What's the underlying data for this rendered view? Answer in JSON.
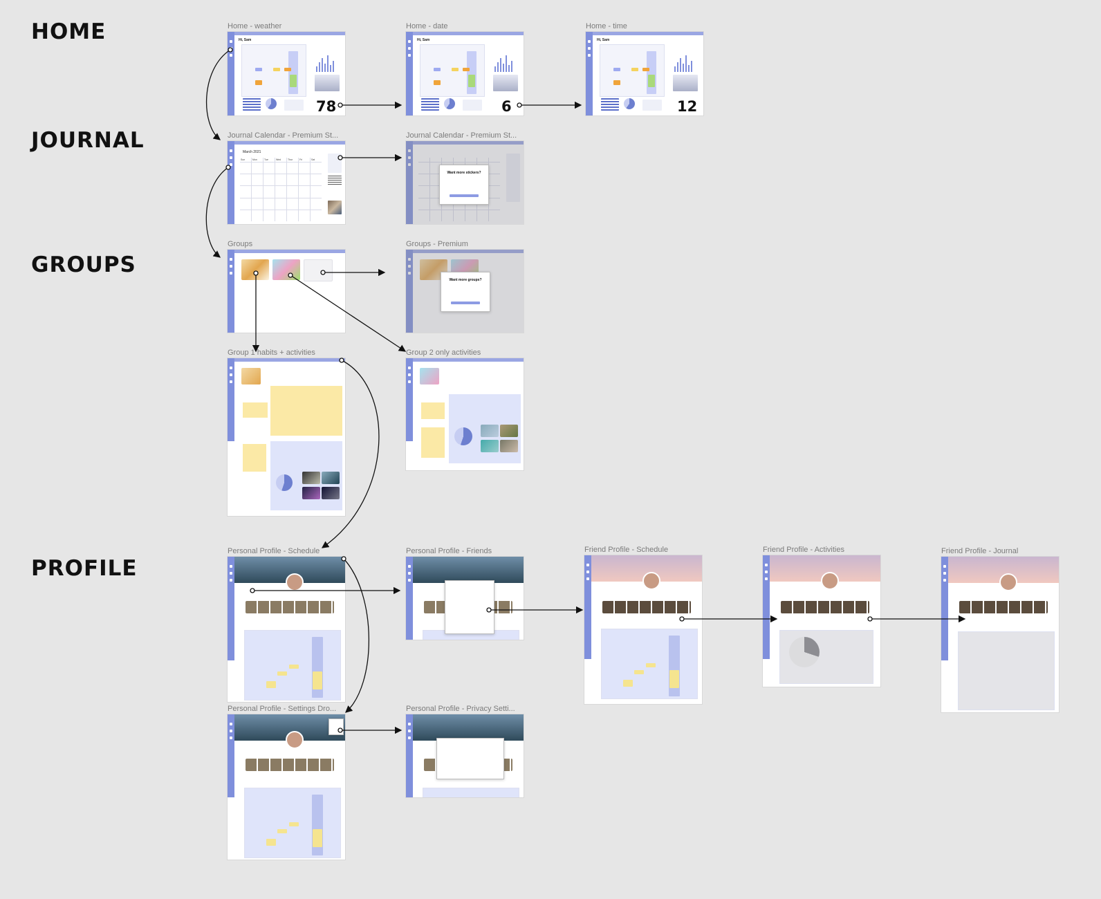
{
  "sections": {
    "home": "HOME",
    "journal": "JOURNAL",
    "groups": "GROUPS",
    "profile": "PROFILE"
  },
  "frames": {
    "home_weather": {
      "title": "Home - weather",
      "greeting": "Hi, Sam",
      "big_value": "78"
    },
    "home_date": {
      "title": "Home - date",
      "greeting": "Hi, Sam",
      "big_value": "6"
    },
    "home_time": {
      "title": "Home - time",
      "greeting": "Hi, Sam",
      "big_value": "12"
    },
    "journal_calendar": {
      "title": "Journal Calendar - Premium St...",
      "month": "March 2021",
      "weekdays": [
        "Sun",
        "Mon",
        "Tue",
        "Wed",
        "Thur",
        "Fri",
        "Sat"
      ]
    },
    "journal_calendar_modal": {
      "title": "Journal Calendar - Premium St...",
      "modal_title": "Want more stickers?"
    },
    "groups": {
      "title": "Groups"
    },
    "groups_premium": {
      "title": "Groups - Premium",
      "modal_title": "Want more groups?"
    },
    "group1": {
      "title": "Group 1 habits + activities"
    },
    "group2": {
      "title": "Group 2 only activities"
    },
    "personal_schedule": {
      "title": "Personal Profile - Schedule"
    },
    "personal_friends": {
      "title": "Personal Profile - Friends"
    },
    "friend_schedule": {
      "title": "Friend Profile - Schedule"
    },
    "friend_activities": {
      "title": "Friend Profile - Activities"
    },
    "friend_journal": {
      "title": "Friend Profile - Journal"
    },
    "personal_settings": {
      "title": "Personal Profile - Settings Dro..."
    },
    "personal_privacy": {
      "title": "Personal Profile - Privacy Setti..."
    }
  },
  "colors": {
    "canvas": "#e6e6e6",
    "sidebar": "#7f8fdc",
    "calendar_block_blue": "#9eaaf0",
    "calendar_block_yellow": "#f5d35f",
    "calendar_block_orange": "#f0a43a",
    "calendar_block_green": "#a9d97a",
    "habit_yellow": "#fbe9a6",
    "activity_blue": "#dfe4fa"
  }
}
